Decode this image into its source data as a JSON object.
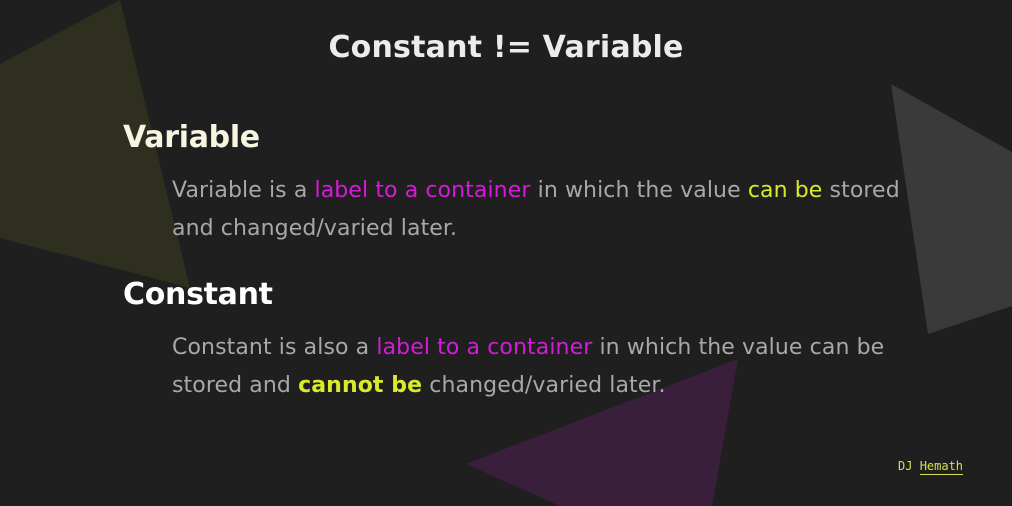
{
  "title": "Constant != Variable",
  "sections": [
    {
      "heading": "Variable",
      "parts": [
        "Variable is a ",
        "label to a container",
        " in which the value ",
        "can be",
        " stored and changed/varied later."
      ]
    },
    {
      "heading": "Constant",
      "parts": [
        "Constant is also a ",
        "label to a container",
        " in which the value can be stored and ",
        "cannot be",
        " changed/varied later."
      ]
    }
  ],
  "signature": {
    "first": "DJ",
    "last": "Hemath"
  },
  "colors": {
    "background": "#1f1f1f",
    "highlight_pink": "#d51ad9",
    "highlight_yellow": "#d9ea2a",
    "body_text": "#a8a8a8",
    "shape_olive": "#2e2f1f",
    "shape_gray": "#3a3a3a",
    "shape_purple": "#3a1f3d"
  }
}
